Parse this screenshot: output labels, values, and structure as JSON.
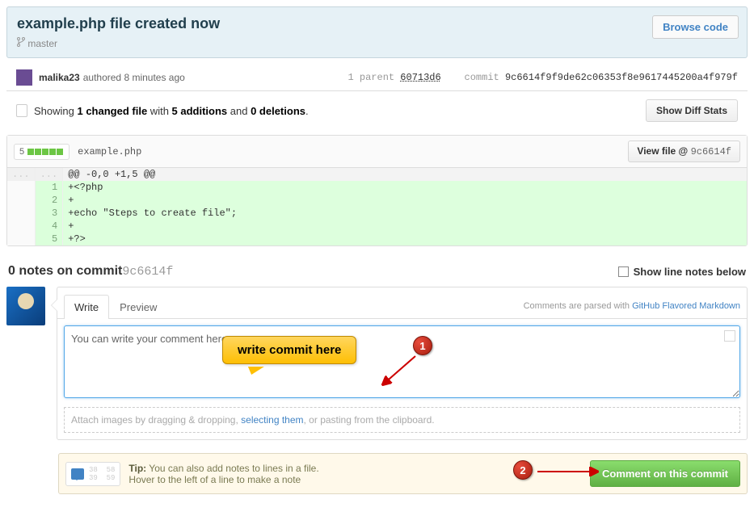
{
  "commit": {
    "title": "example.php file created now",
    "branch": "master",
    "browse_label": "Browse code",
    "author": "malika23",
    "authored_verb": "authored",
    "authored_time": "8 minutes ago",
    "parent_label": "1 parent",
    "parent_sha": "60713d6",
    "commit_label": "commit",
    "full_sha": "9c6614f9f9de62c06353f8e9617445200a4f979f",
    "short_sha": "9c6614f"
  },
  "diffstats": {
    "showing_prefix": "Showing ",
    "files": "1 changed file",
    "with": " with ",
    "additions": "5 additions",
    "and": " and ",
    "deletions": "0 deletions",
    "period": ".",
    "show_diff_btn": "Show Diff Stats"
  },
  "file": {
    "add_count": "5",
    "name": "example.php",
    "view_label": "View file @ ",
    "hunk": "@@ -0,0 +1,5 @@",
    "lines": [
      {
        "n": "1",
        "t": "+<?php"
      },
      {
        "n": "2",
        "t": "+"
      },
      {
        "n": "3",
        "t": "+echo \"Steps to create file\";"
      },
      {
        "n": "4",
        "t": "+"
      },
      {
        "n": "5",
        "t": "+?>"
      }
    ]
  },
  "notes": {
    "heading_prefix": "0 notes on commit ",
    "show_line_notes": "Show line notes below"
  },
  "comment": {
    "tab_write": "Write",
    "tab_preview": "Preview",
    "gfm_prefix": "Comments are parsed with ",
    "gfm_link": "GitHub Flavored Markdown",
    "textarea_value": "You can write your comment here.",
    "attach_prefix": "Attach images by dragging & dropping, ",
    "attach_link": "selecting them",
    "attach_suffix": ", or pasting from the clipboard."
  },
  "callout": {
    "text": "write commit here"
  },
  "tip": {
    "label": "Tip:",
    "line1": " You can also add notes to lines in a file.",
    "line2": "Hover to the left of a line to make a note",
    "nums": "38  58\n39  59"
  },
  "submit": {
    "label": "Comment on this commit"
  },
  "badges": {
    "one": "1",
    "two": "2"
  }
}
